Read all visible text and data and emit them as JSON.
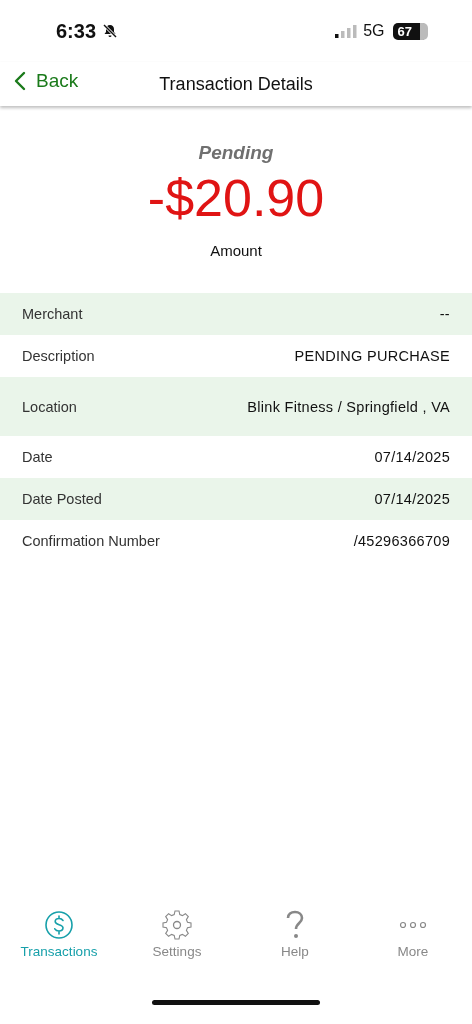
{
  "status_bar": {
    "time": "6:33",
    "network": "5G",
    "battery": "67"
  },
  "nav": {
    "back": "Back",
    "title": "Transaction Details"
  },
  "summary": {
    "status": "Pending",
    "amount": "-$20.90",
    "label": "Amount"
  },
  "details": [
    {
      "label": "Merchant",
      "value": "--"
    },
    {
      "label": "Description",
      "value": "PENDING PURCHASE"
    },
    {
      "label": "Location",
      "value": "Blink Fitness / Springfield , VA",
      "tall": true
    },
    {
      "label": "Date",
      "value": "07/14/2025"
    },
    {
      "label": "Date Posted",
      "value": "07/14/2025"
    },
    {
      "label": "Confirmation Number",
      "value": "/45296366709"
    }
  ],
  "tabs": [
    {
      "label": "Transactions",
      "kind": "dollar",
      "selected": true
    },
    {
      "label": "Settings",
      "kind": "gear",
      "selected": false
    },
    {
      "label": "Help",
      "kind": "question",
      "selected": false
    },
    {
      "label": "More",
      "kind": "dots",
      "selected": false
    }
  ]
}
